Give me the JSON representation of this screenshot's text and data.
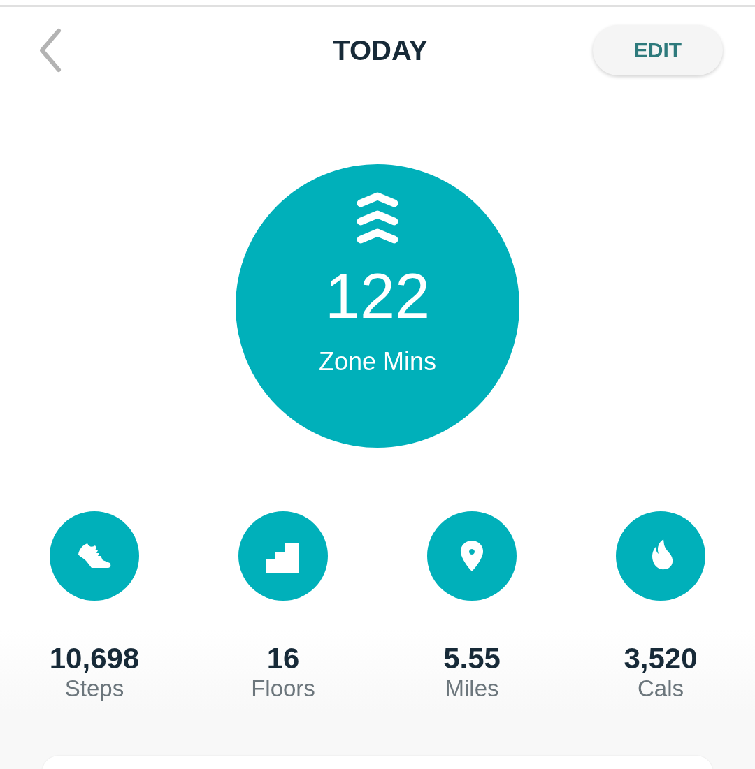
{
  "header": {
    "title": "TODAY",
    "edit_button": "EDIT"
  },
  "zone": {
    "value": "122",
    "label": "Zone Mins"
  },
  "stats": [
    {
      "kind": "steps",
      "value": "10,698",
      "label": "Steps"
    },
    {
      "kind": "floors",
      "value": "16",
      "label": "Floors"
    },
    {
      "kind": "distance",
      "value": "5.55",
      "label": "Miles"
    },
    {
      "kind": "calories",
      "value": "3,520",
      "label": "Cals"
    }
  ]
}
